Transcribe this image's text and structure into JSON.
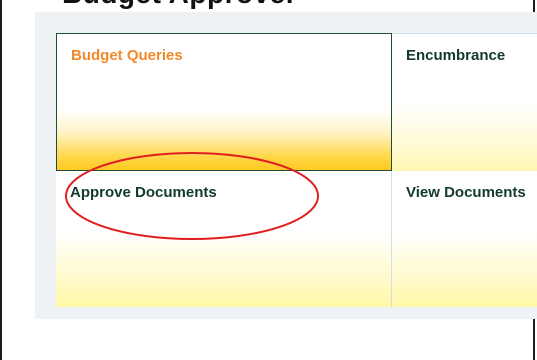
{
  "header": {
    "title": "Budget Approver"
  },
  "tiles": [
    {
      "label": "Budget Queries",
      "state": "hover"
    },
    {
      "label": "Encumbrance"
    },
    {
      "label": "Approve Documents",
      "highlighted": true
    },
    {
      "label": "View Documents"
    }
  ],
  "colors": {
    "active_label": "#f28a2c",
    "label": "#123b2a",
    "highlight_circle": "#e02020"
  }
}
